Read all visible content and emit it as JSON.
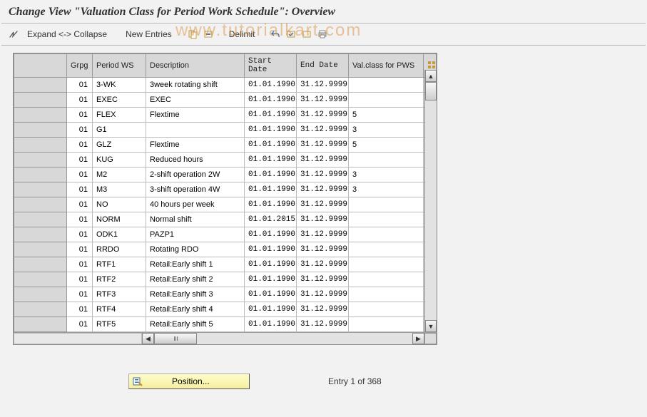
{
  "header": {
    "title": "Change View \"Valuation Class for Period Work Schedule\": Overview"
  },
  "toolbar": {
    "expand_collapse_label": "Expand <-> Collapse",
    "new_entries_label": "New Entries",
    "delimit_label": "Delimit"
  },
  "watermark": "www.tutorialkart.com",
  "table": {
    "headers": {
      "grpg": "Grpg",
      "period_ws": "Period WS",
      "description": "Description",
      "start_date": "Start Date",
      "end_date": "End Date",
      "val_class": "Val.class for PWS"
    },
    "rows": [
      {
        "grpg": "01",
        "pws": "3-WK",
        "desc": "3week rotating shift",
        "start": "01.01.1990",
        "end": "31.12.9999",
        "val": ""
      },
      {
        "grpg": "01",
        "pws": "EXEC",
        "desc": "EXEC",
        "start": "01.01.1990",
        "end": "31.12.9999",
        "val": ""
      },
      {
        "grpg": "01",
        "pws": "FLEX",
        "desc": "Flextime",
        "start": "01.01.1990",
        "end": "31.12.9999",
        "val": "5"
      },
      {
        "grpg": "01",
        "pws": "G1",
        "desc": "",
        "start": "01.01.1990",
        "end": "31.12.9999",
        "val": "3"
      },
      {
        "grpg": "01",
        "pws": "GLZ",
        "desc": "Flextime",
        "start": "01.01.1990",
        "end": "31.12.9999",
        "val": "5"
      },
      {
        "grpg": "01",
        "pws": "KUG",
        "desc": "Reduced hours",
        "start": "01.01.1990",
        "end": "31.12.9999",
        "val": ""
      },
      {
        "grpg": "01",
        "pws": "M2",
        "desc": "2-shift operation 2W",
        "start": "01.01.1990",
        "end": "31.12.9999",
        "val": "3"
      },
      {
        "grpg": "01",
        "pws": "M3",
        "desc": "3-shift operation 4W",
        "start": "01.01.1990",
        "end": "31.12.9999",
        "val": "3"
      },
      {
        "grpg": "01",
        "pws": "NO",
        "desc": "40 hours per week",
        "start": "01.01.1990",
        "end": "31.12.9999",
        "val": ""
      },
      {
        "grpg": "01",
        "pws": "NORM",
        "desc": "Normal shift",
        "start": "01.01.2015",
        "end": "31.12.9999",
        "val": ""
      },
      {
        "grpg": "01",
        "pws": "ODK1",
        "desc": "PAZP1",
        "start": "01.01.1990",
        "end": "31.12.9999",
        "val": ""
      },
      {
        "grpg": "01",
        "pws": "RRDO",
        "desc": "Rotating RDO",
        "start": "01.01.1990",
        "end": "31.12.9999",
        "val": ""
      },
      {
        "grpg": "01",
        "pws": "RTF1",
        "desc": "Retail:Early shift 1",
        "start": "01.01.1990",
        "end": "31.12.9999",
        "val": ""
      },
      {
        "grpg": "01",
        "pws": "RTF2",
        "desc": "Retail:Early shift 2",
        "start": "01.01.1990",
        "end": "31.12.9999",
        "val": ""
      },
      {
        "grpg": "01",
        "pws": "RTF3",
        "desc": "Retail:Early shift 3",
        "start": "01.01.1990",
        "end": "31.12.9999",
        "val": ""
      },
      {
        "grpg": "01",
        "pws": "RTF4",
        "desc": "Retail:Early shift 4",
        "start": "01.01.1990",
        "end": "31.12.9999",
        "val": ""
      },
      {
        "grpg": "01",
        "pws": "RTF5",
        "desc": "Retail:Early shift 5",
        "start": "01.01.1990",
        "end": "31.12.9999",
        "val": ""
      }
    ]
  },
  "footer": {
    "position_label": "Position...",
    "entry_label": "Entry 1 of 368"
  }
}
